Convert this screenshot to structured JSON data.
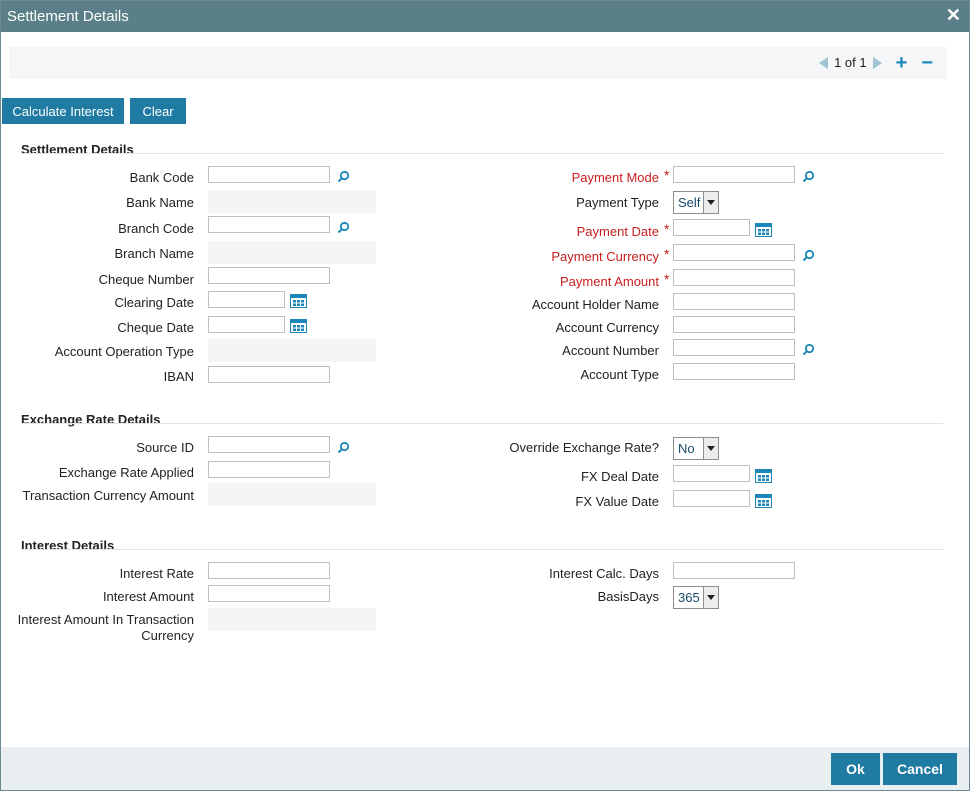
{
  "window": {
    "title": "Settlement Details",
    "close_glyph": "✕"
  },
  "pager": {
    "text": "1 of 1",
    "add": "+",
    "remove": "−"
  },
  "actions": {
    "calculate": "Calculate Interest",
    "clear": "Clear"
  },
  "sections": {
    "settlement": "Settlement Details",
    "exchange": "Exchange Rate Details",
    "interest": "Interest Details"
  },
  "settlement_left": {
    "bank_code": "Bank Code",
    "bank_name": "Bank Name",
    "branch_code": "Branch Code",
    "branch_name": "Branch Name",
    "cheque_number": "Cheque Number",
    "clearing_date": "Clearing Date",
    "cheque_date": "Cheque Date",
    "account_operation_type": "Account Operation Type",
    "iban": "IBAN"
  },
  "settlement_right": {
    "payment_mode": "Payment Mode",
    "payment_type": "Payment Type",
    "payment_type_value": "Self",
    "payment_date": "Payment Date",
    "payment_currency": "Payment Currency",
    "payment_amount": "Payment Amount",
    "account_holder_name": "Account Holder Name",
    "account_currency": "Account Currency",
    "account_number": "Account Number",
    "account_type": "Account Type",
    "required_mark": "*"
  },
  "exchange": {
    "source_id": "Source ID",
    "exchange_rate_applied": "Exchange Rate Applied",
    "transaction_currency_amount": "Transaction Currency Amount",
    "override_exchange_rate": "Override Exchange Rate?",
    "override_value": "No",
    "fx_deal_date": "FX Deal Date",
    "fx_value_date": "FX Value Date"
  },
  "interest": {
    "interest_rate": "Interest Rate",
    "interest_amount": "Interest Amount",
    "interest_amount_txn_line1": "Interest Amount In Transaction",
    "interest_amount_txn_line2": "Currency",
    "interest_calc_days": "Interest Calc. Days",
    "basis_days": "BasisDays",
    "basis_days_value": "365"
  },
  "footer": {
    "ok": "Ok",
    "cancel": "Cancel"
  },
  "colors": {
    "title_bar": "#5b7f88",
    "button": "#1f7ba1",
    "required": "#c81e1e",
    "icon": "#1b87b8"
  }
}
